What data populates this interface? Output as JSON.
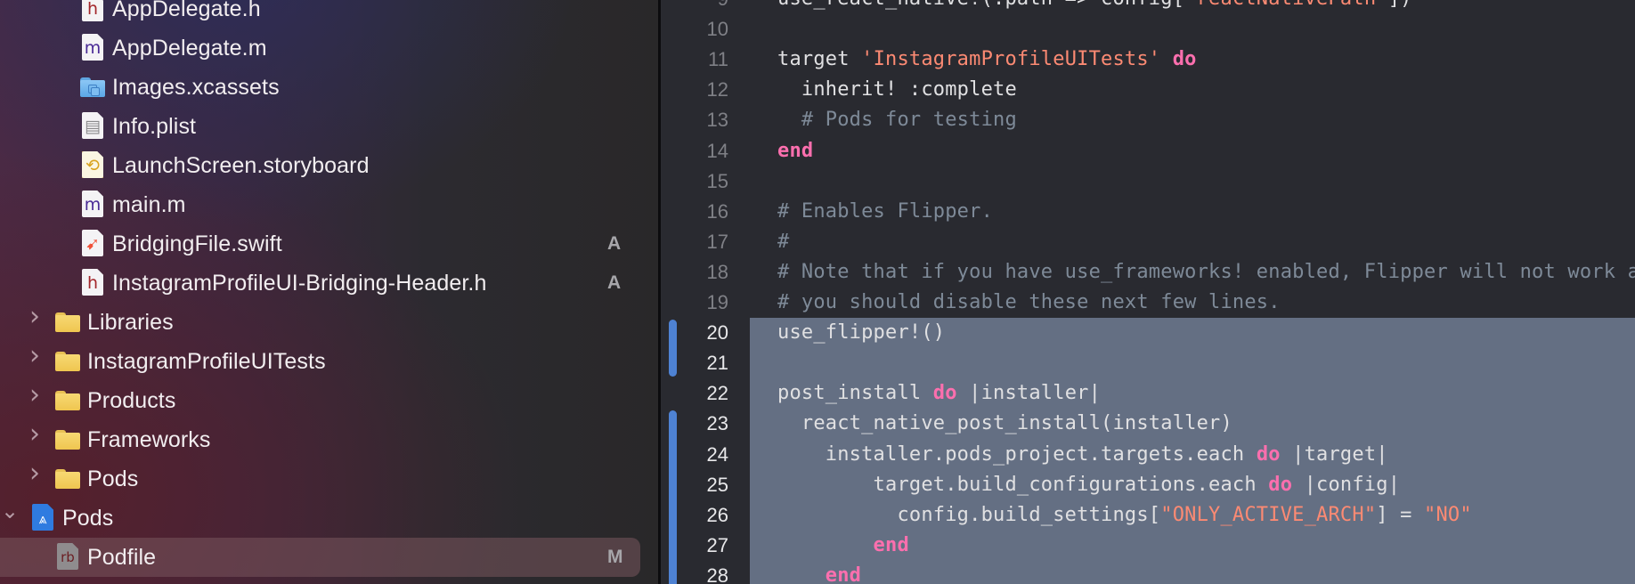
{
  "navigator": {
    "items": [
      {
        "label": "AppDelegate.h",
        "icon": "header-file-icon",
        "glyph": "h",
        "indent": 2,
        "badge": ""
      },
      {
        "label": "AppDelegate.m",
        "icon": "objc-file-icon",
        "glyph": "m",
        "indent": 2,
        "badge": ""
      },
      {
        "label": "Images.xcassets",
        "icon": "asset-catalog-icon",
        "glyph": "",
        "indent": 2,
        "badge": ""
      },
      {
        "label": "Info.plist",
        "icon": "plist-file-icon",
        "glyph": "",
        "indent": 2,
        "badge": ""
      },
      {
        "label": "LaunchScreen.storyboard",
        "icon": "storyboard-file-icon",
        "glyph": "",
        "indent": 2,
        "badge": ""
      },
      {
        "label": "main.m",
        "icon": "objc-file-icon",
        "glyph": "m",
        "indent": 2,
        "badge": ""
      },
      {
        "label": "BridgingFile.swift",
        "icon": "swift-file-icon",
        "glyph": "",
        "indent": 2,
        "badge": "A"
      },
      {
        "label": "InstagramProfileUI-Bridging-Header.h",
        "icon": "header-file-icon",
        "glyph": "h",
        "indent": 2,
        "badge": "A"
      },
      {
        "label": "Libraries",
        "icon": "folder-icon",
        "glyph": "",
        "indent": 1,
        "badge": "",
        "disclosure": "collapsed"
      },
      {
        "label": "InstagramProfileUITests",
        "icon": "folder-icon",
        "glyph": "",
        "indent": 1,
        "badge": "",
        "disclosure": "collapsed"
      },
      {
        "label": "Products",
        "icon": "folder-icon",
        "glyph": "",
        "indent": 1,
        "badge": "",
        "disclosure": "collapsed"
      },
      {
        "label": "Frameworks",
        "icon": "folder-icon",
        "glyph": "",
        "indent": 1,
        "badge": "",
        "disclosure": "collapsed"
      },
      {
        "label": "Pods",
        "icon": "folder-icon",
        "glyph": "",
        "indent": 1,
        "badge": "",
        "disclosure": "collapsed"
      },
      {
        "label": "Pods",
        "icon": "xcode-project-icon",
        "glyph": "",
        "indent": 0,
        "badge": "",
        "disclosure": "expanded"
      },
      {
        "label": "Podfile",
        "icon": "ruby-file-icon",
        "glyph": "rb",
        "indent": 1,
        "badge": "M",
        "selected": true
      }
    ]
  },
  "editor": {
    "selection_start_line": 20,
    "changed_ranges": [
      [
        20,
        21
      ],
      [
        23,
        28
      ]
    ],
    "lines": [
      {
        "n": "9",
        "tokens": [
          [
            "plain",
            "use_react_native!(:path => config["
          ],
          [
            "str",
            "\"reactNativePath\""
          ],
          [
            "plain",
            "])"
          ]
        ]
      },
      {
        "n": "10",
        "tokens": []
      },
      {
        "n": "11",
        "tokens": [
          [
            "plain",
            "target "
          ],
          [
            "str",
            "'InstagramProfileUITests'"
          ],
          [
            "plain",
            " "
          ],
          [
            "kw",
            "do"
          ]
        ]
      },
      {
        "n": "12",
        "tokens": [
          [
            "plain",
            "  inherit! :complete"
          ]
        ]
      },
      {
        "n": "13",
        "tokens": [
          [
            "cm",
            "  # Pods for testing"
          ]
        ]
      },
      {
        "n": "14",
        "tokens": [
          [
            "kw",
            "end"
          ]
        ]
      },
      {
        "n": "15",
        "tokens": []
      },
      {
        "n": "16",
        "tokens": [
          [
            "cm",
            "# Enables Flipper."
          ]
        ]
      },
      {
        "n": "17",
        "tokens": [
          [
            "cm",
            "#"
          ]
        ]
      },
      {
        "n": "18",
        "tokens": [
          [
            "cm",
            "# Note that if you have use_frameworks! enabled, Flipper will not work and"
          ]
        ]
      },
      {
        "n": "19",
        "tokens": [
          [
            "cm",
            "# you should disable these next few lines."
          ]
        ]
      },
      {
        "n": "20",
        "tokens": [
          [
            "plain",
            "use_flipper!()"
          ]
        ]
      },
      {
        "n": "21",
        "tokens": []
      },
      {
        "n": "22",
        "tokens": [
          [
            "plain",
            "post_install "
          ],
          [
            "kw",
            "do"
          ],
          [
            "plain",
            " |installer|"
          ]
        ]
      },
      {
        "n": "23",
        "tokens": [
          [
            "plain",
            "  react_native_post_install(installer)"
          ]
        ]
      },
      {
        "n": "24",
        "tokens": [
          [
            "plain",
            "    installer.pods_project.targets.each "
          ],
          [
            "kw",
            "do"
          ],
          [
            "plain",
            " |target|"
          ]
        ]
      },
      {
        "n": "25",
        "tokens": [
          [
            "plain",
            "        target.build_configurations.each "
          ],
          [
            "kw",
            "do"
          ],
          [
            "plain",
            " |config|"
          ]
        ]
      },
      {
        "n": "26",
        "tokens": [
          [
            "plain",
            "          config.build_settings["
          ],
          [
            "str",
            "\"ONLY_ACTIVE_ARCH\""
          ],
          [
            "plain",
            "] = "
          ],
          [
            "str",
            "\"NO\""
          ]
        ]
      },
      {
        "n": "27",
        "tokens": [
          [
            "kw",
            "        end"
          ]
        ]
      },
      {
        "n": "28",
        "tokens": [
          [
            "kw",
            "    end"
          ]
        ]
      }
    ]
  },
  "colors": {
    "keyword": "#fc6fae",
    "string": "#fc8a73",
    "comment": "#7e8a98",
    "selection": "#646f83",
    "change_bar": "#4e82d3",
    "editor_bg": "#292a30"
  }
}
